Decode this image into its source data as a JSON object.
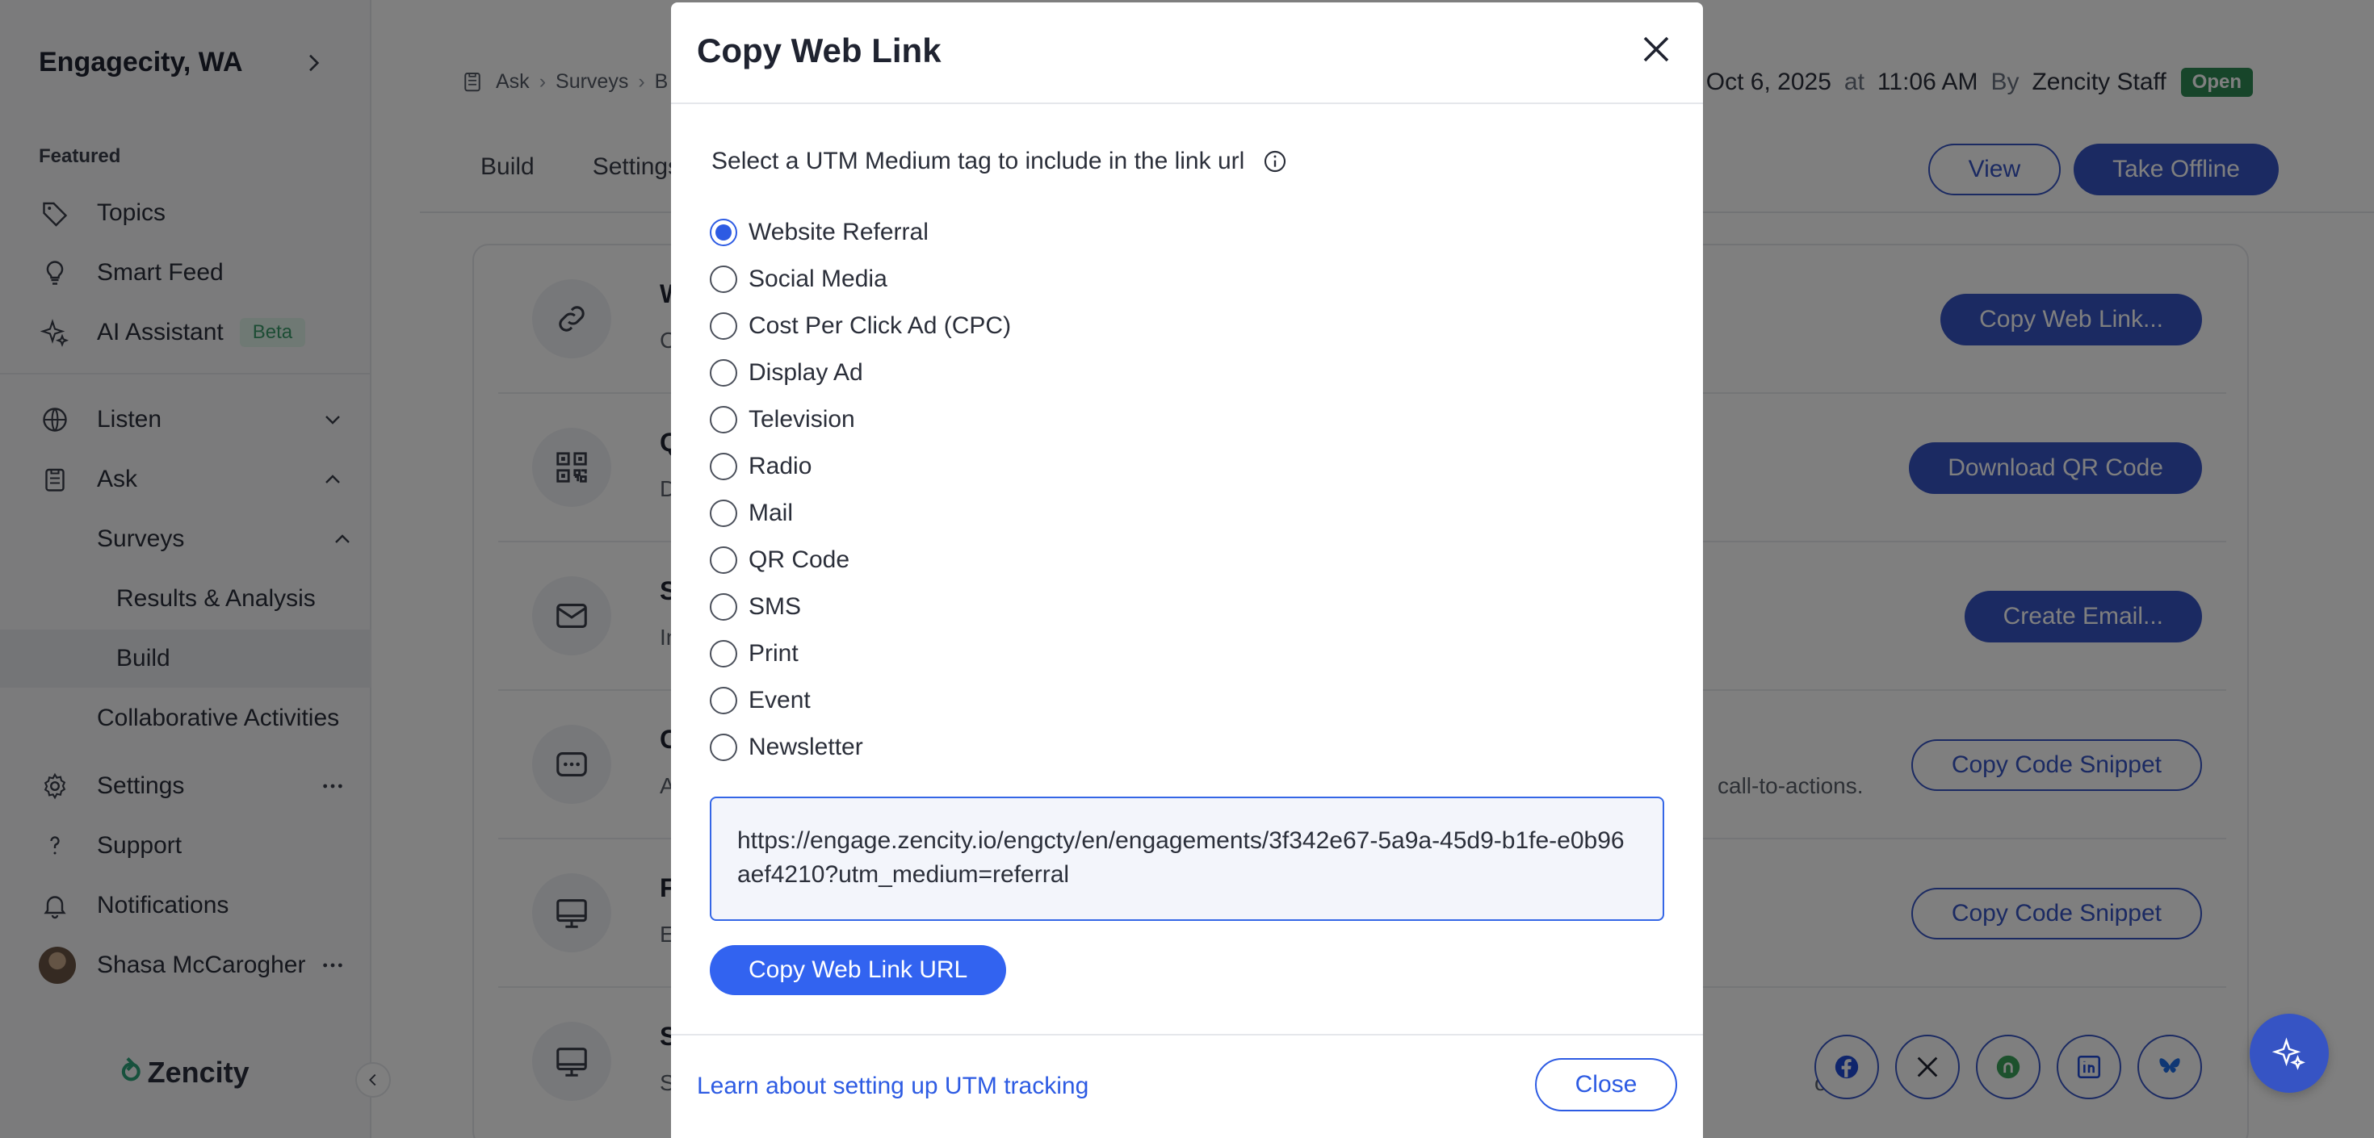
{
  "sidebar": {
    "org_name": "Engagecity, WA",
    "section_label": "Featured",
    "featured": [
      {
        "label": "Topics",
        "icon": "tag-icon"
      },
      {
        "label": "Smart Feed",
        "icon": "lightbulb-icon"
      },
      {
        "label": "AI Assistant",
        "icon": "sparkle-icon",
        "badge": "Beta"
      }
    ],
    "nav": [
      {
        "label": "Listen",
        "icon": "globe-icon"
      },
      {
        "label": "Ask",
        "icon": "clipboard-icon"
      }
    ],
    "ask_children": {
      "surveys": "Surveys",
      "results": "Results & Analysis",
      "build": "Build",
      "collab": "Collaborative Activities"
    },
    "bottom": [
      {
        "label": "Settings",
        "icon": "gear-icon"
      },
      {
        "label": "Support",
        "icon": "question-icon"
      },
      {
        "label": "Notifications",
        "icon": "bell-icon"
      }
    ],
    "user_name": "Shasa McCarogher",
    "logo_text": "Zencity"
  },
  "header": {
    "breadcrumb": [
      "Ask",
      "Surveys",
      "B"
    ],
    "date": "Oct 6, 2025",
    "at": "at",
    "time": "11:06 AM",
    "by": "By",
    "author": "Zencity Staff",
    "status": "Open",
    "tabs": [
      "Build",
      "Settings"
    ],
    "view_label": "View",
    "offline_label": "Take Offline"
  },
  "share_rows": [
    {
      "title": "We",
      "desc": "Co",
      "desc_tail": "",
      "action": "Copy Web Link...",
      "style": "solid",
      "icon": "link-icon"
    },
    {
      "title": "QR",
      "desc": "Do",
      "desc_tail": "",
      "action": "Download QR Code",
      "style": "solid",
      "icon": "qr-icon"
    },
    {
      "title": "Se",
      "desc": "Invi",
      "desc_tail": "",
      "action": "Create Email...",
      "style": "solid",
      "icon": "mail-icon"
    },
    {
      "title": "CT",
      "desc": "Ad",
      "desc_tail": "call-to-actions.",
      "action": "Copy Code Snippet",
      "style": "outline",
      "icon": "chat-icon"
    },
    {
      "title": "Fu",
      "desc": "Em",
      "desc_tail": "",
      "action": "Copy Code Snippet",
      "style": "outline",
      "icon": "monitor-icon"
    },
    {
      "title": "So",
      "desc": "Sha",
      "desc_tail": "ount.",
      "action": "",
      "style": "social",
      "icon": "monitor-icon"
    }
  ],
  "modal": {
    "title": "Copy Web Link",
    "prompt": "Select a UTM Medium tag to include in the link url",
    "options": [
      "Website Referral",
      "Social Media",
      "Cost Per Click Ad (CPC)",
      "Display Ad",
      "Television",
      "Radio",
      "Mail",
      "QR Code",
      "SMS",
      "Print",
      "Event",
      "Newsletter"
    ],
    "selected": "Website Referral",
    "url": "https://engage.zencity.io/engcty/en/engagements/3f342e67-5a9a-45d9-b1fe-e0b96aef4210?utm_medium=referral",
    "copy_button": "Copy Web Link URL",
    "learn_link": "Learn about setting up UTM tracking",
    "close_button": "Close"
  },
  "colors": {
    "primary": "#3654c4",
    "radio_selected": "#2d5be3",
    "status_open": "#2f8a55",
    "beta_bg": "#dff3e8"
  }
}
